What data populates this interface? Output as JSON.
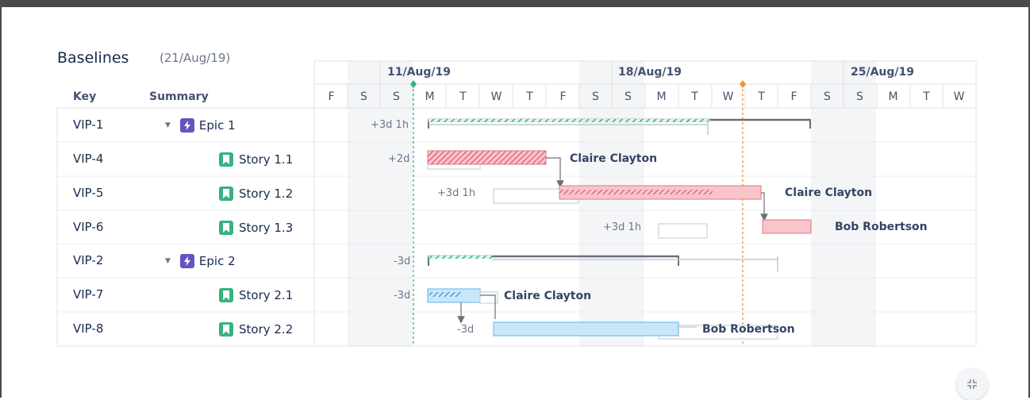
{
  "title": "Baselines",
  "baseline_date": "(21/Aug/19)",
  "columns": {
    "key": "Key",
    "summary": "Summary"
  },
  "weeks": [
    "11/Aug/19",
    "18/Aug/19",
    "25/Aug/19"
  ],
  "days": [
    "F",
    "S",
    "S",
    "M",
    "T",
    "W",
    "T",
    "F",
    "S",
    "S",
    "M",
    "T",
    "W",
    "T",
    "F",
    "S",
    "S",
    "M",
    "T",
    "W"
  ],
  "rows": [
    {
      "key": "VIP-1",
      "summary": "Epic 1",
      "type": "epic",
      "icon": "epic-icon",
      "offset": "+3d 1h",
      "assignee": ""
    },
    {
      "key": "VIP-4",
      "summary": "Story 1.1",
      "type": "story",
      "icon": "story-icon",
      "offset": "+2d",
      "assignee": "Claire Clayton"
    },
    {
      "key": "VIP-5",
      "summary": "Story 1.2",
      "type": "story",
      "icon": "story-icon",
      "offset": "+3d 1h",
      "assignee": "Claire Clayton"
    },
    {
      "key": "VIP-6",
      "summary": "Story 1.3",
      "type": "story",
      "icon": "story-icon",
      "offset": "+3d 1h",
      "assignee": "Bob Robertson"
    },
    {
      "key": "VIP-2",
      "summary": "Epic 2",
      "type": "epic",
      "icon": "epic-icon",
      "offset": "-3d",
      "assignee": ""
    },
    {
      "key": "VIP-7",
      "summary": "Story 2.1",
      "type": "story",
      "icon": "story-icon",
      "offset": "-3d",
      "assignee": "Claire Clayton"
    },
    {
      "key": "VIP-8",
      "summary": "Story 2.2",
      "type": "story",
      "icon": "story-icon",
      "offset": "-3d",
      "assignee": "Bob Robertson"
    }
  ],
  "colors": {
    "epic_line": "#6b6f7b",
    "progress_green": "#36b37e",
    "red_bar": "#f7c4cc",
    "red_border": "#e5787d",
    "blue_bar": "#c8e8fa",
    "blue_border": "#5bb5e8",
    "baseline_gray": "#c1c7d0",
    "today_line": "#36b37e",
    "baseline_line": "#f0962d"
  },
  "collapse_icon": "collapse-icon"
}
